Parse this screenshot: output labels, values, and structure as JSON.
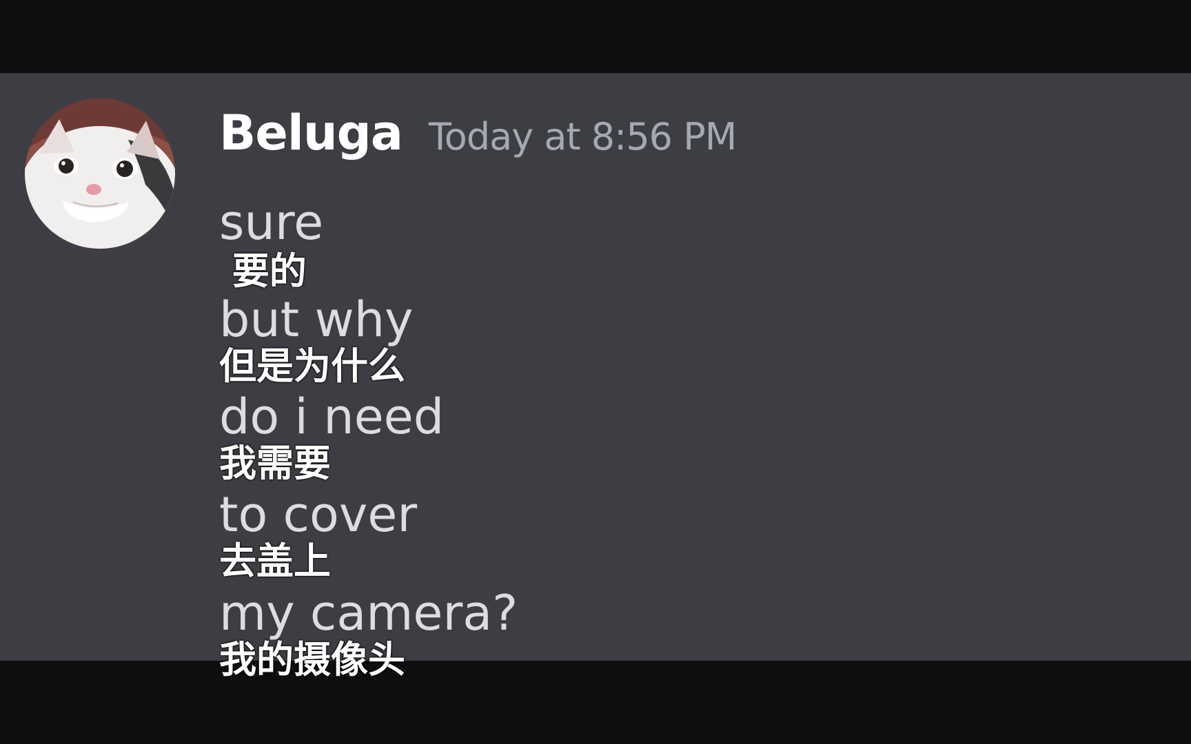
{
  "message": {
    "author": "Beluga",
    "timestamp": "Today at 8:56 PM",
    "avatar_icon": "beluga-cat-avatar"
  },
  "lines": [
    {
      "text": "sure",
      "subtitle": " 要的"
    },
    {
      "text": "but why",
      "subtitle": "但是为什么"
    },
    {
      "text": "do i need",
      "subtitle": "我需要"
    },
    {
      "text": "to cover",
      "subtitle": "去盖上"
    },
    {
      "text": "my camera?",
      "subtitle": "我的摄像头"
    }
  ],
  "colors": {
    "background": "#0e0e0f",
    "panel": "#3d3e43",
    "username": "#ffffff",
    "timestamp": "#a7a9b0",
    "message_text": "#dcdde0",
    "subtitle_text": "#ffffff"
  }
}
